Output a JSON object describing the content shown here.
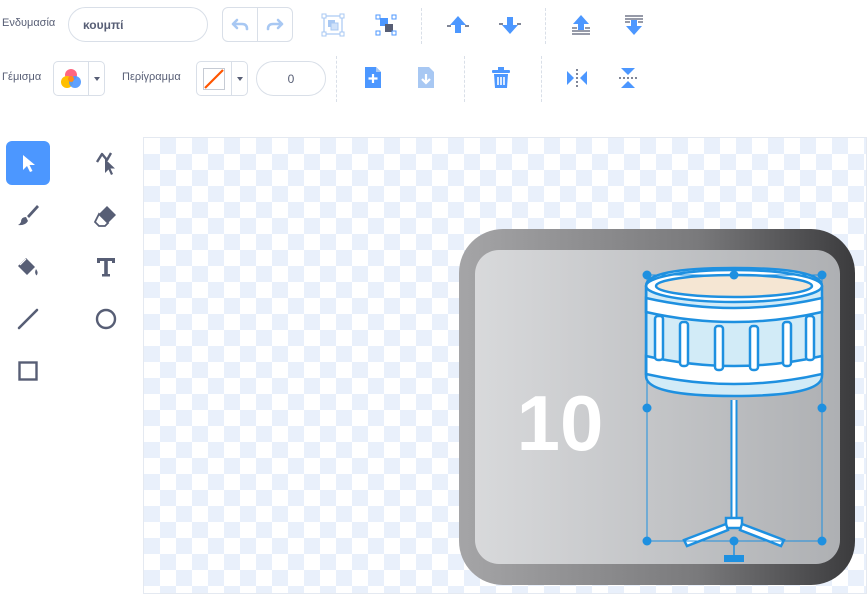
{
  "toolbar": {
    "costume_label": "Ενδυμασία",
    "costume_name": "κουμπί",
    "fill_label": "Γέμισμα",
    "outline_label": "Περίγραμμα",
    "outline_width": "0"
  },
  "canvas": {
    "number_text": "10"
  },
  "colors": {
    "accent": "#4c97ff",
    "selection": "#1e90e0",
    "text": "#575e75",
    "checker": "#e9f0fb"
  }
}
